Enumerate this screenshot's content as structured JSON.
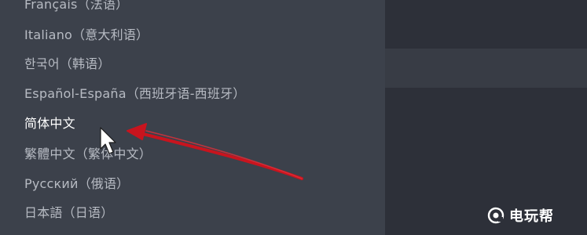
{
  "language_menu": {
    "items": [
      {
        "label": "Français（法语）"
      },
      {
        "label": "Italiano（意大利语）"
      },
      {
        "label": "한국어（韩语）"
      },
      {
        "label": "Español-España（西班牙语-西班牙）"
      },
      {
        "label": "简体中文",
        "hovered": true
      },
      {
        "label": "繁體中文（繁体中文）"
      },
      {
        "label": "Русский（俄语）"
      },
      {
        "label": "日本語（日语）"
      }
    ]
  },
  "annotation": {
    "arrow_color": "#c8141e",
    "points_to": "简体中文"
  },
  "watermark": {
    "text": "电玩帮"
  },
  "colors": {
    "menu_background": "#3c414b",
    "page_background": "#2b2f38",
    "item_text": "#b7bbc3",
    "hover_text": "#ffffff"
  }
}
